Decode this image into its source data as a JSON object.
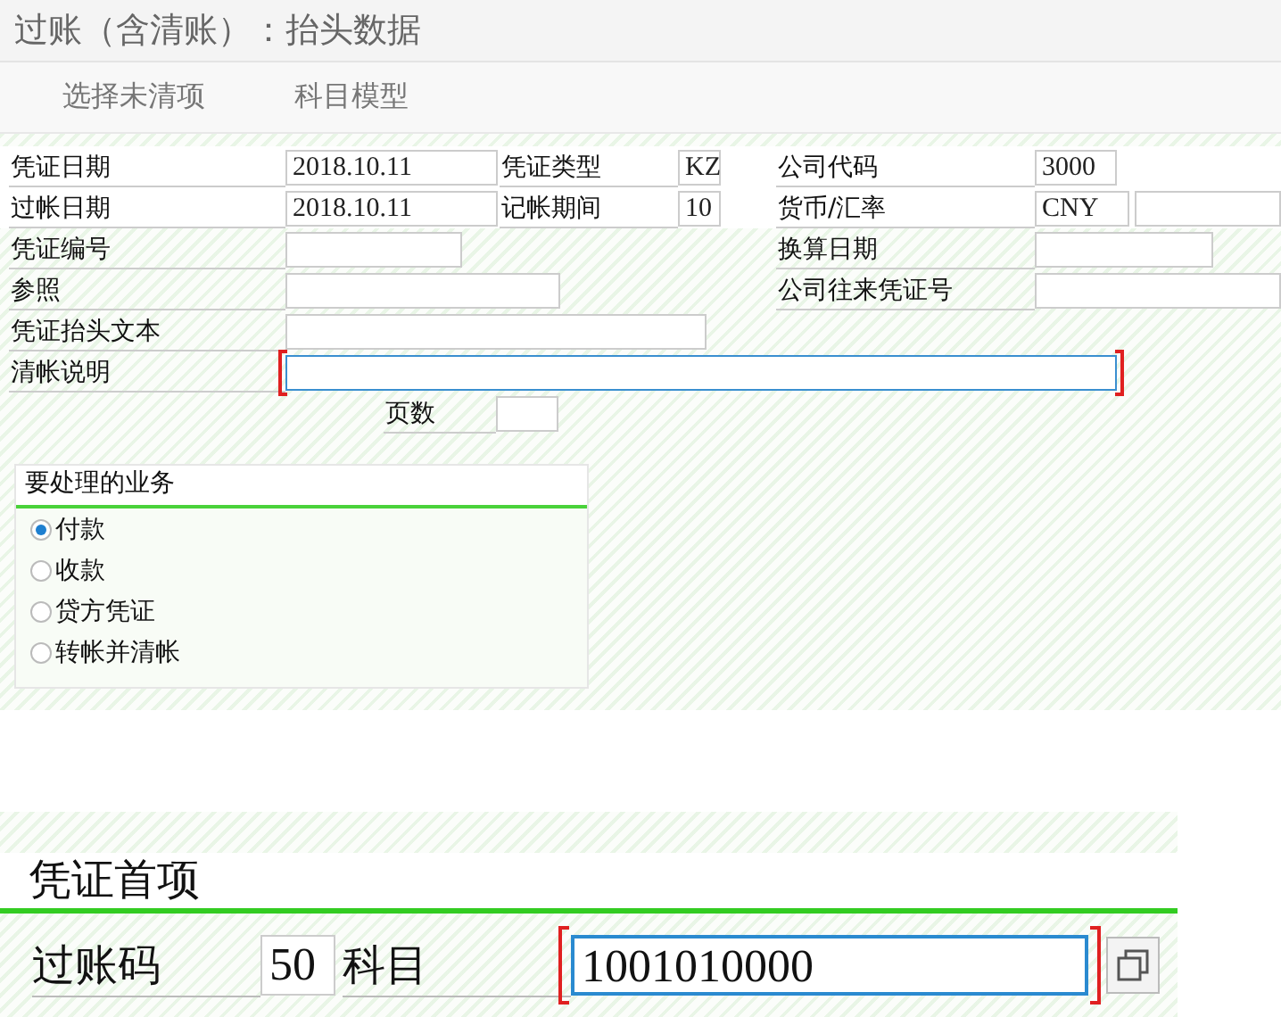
{
  "window": {
    "title": "过账（含清账）：抬头数据"
  },
  "toolbar": [
    "选择未清项",
    "科目模型"
  ],
  "header_rows": [
    [
      {
        "kind": "labeled_field",
        "label": "凭证日期",
        "value": "2018.10.11",
        "focused": false
      },
      {
        "kind": "labeled_field",
        "label": "凭证类型",
        "value": "KZ",
        "focused": false
      },
      {
        "kind": "labeled_field",
        "label": "公司代码",
        "value": "3000",
        "focused": false
      }
    ],
    [
      {
        "kind": "labeled_field",
        "label": "过帐日期",
        "value": "2018.10.11",
        "focused": false
      },
      {
        "kind": "labeled_field",
        "label": "记帐期间",
        "value": "10",
        "focused": false
      },
      {
        "kind": "labeled_field",
        "label": "货币/汇率",
        "value": "CNY",
        "focused": false
      },
      {
        "kind": "field",
        "focused": false
      }
    ],
    [
      {
        "kind": "labeled_field",
        "label": "凭证编号",
        "focused": false
      },
      {
        "kind": "labeled_field",
        "label": "换算日期",
        "focused": false
      }
    ],
    [
      {
        "kind": "labeled_field",
        "label": "参照",
        "focused": false
      },
      {
        "kind": "labeled_field",
        "label": "公司往来凭证号",
        "focused": false
      }
    ],
    [
      {
        "kind": "labeled_field",
        "label": "凭证抬头文本",
        "focused": false
      }
    ],
    [
      {
        "kind": "labeled_field",
        "label": "清帐说明",
        "focused": true
      }
    ],
    [
      {
        "kind": "labeled_field",
        "label": "页数",
        "focused": false
      }
    ]
  ],
  "transaction_group": {
    "title": "要处理的业务",
    "options": [
      {
        "label": "付款",
        "selected": true
      },
      {
        "label": "收款",
        "selected": false
      },
      {
        "label": "贷方凭证",
        "selected": false
      },
      {
        "label": "转帐并清帐",
        "selected": false
      }
    ]
  },
  "first_item": {
    "title": "凭证首项",
    "posting_key": {
      "label": "过账码",
      "value": "50"
    },
    "account": {
      "label": "科目",
      "value": "1001010000",
      "focused": true
    }
  }
}
